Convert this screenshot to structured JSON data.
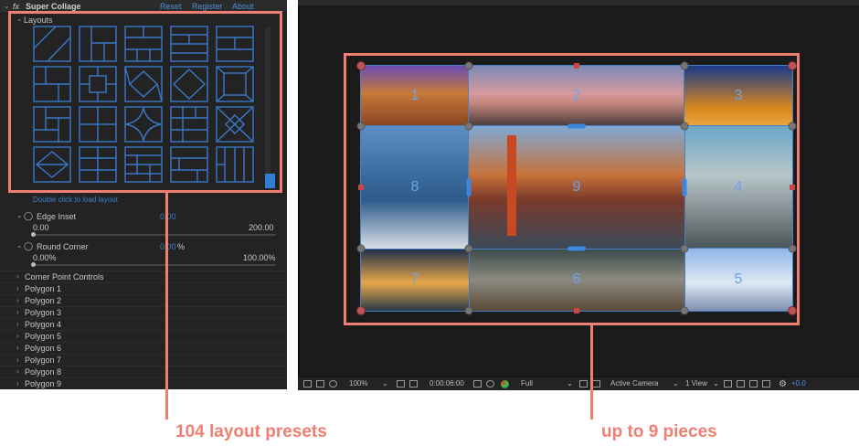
{
  "panel": {
    "fx_icon": "fx-icon",
    "title": "Super Collage",
    "links": [
      "Reset",
      "Register",
      "About"
    ],
    "layouts_label": "Layouts",
    "hint": "Double click to load layout",
    "edge_inset": {
      "label": "Edge Inset",
      "value": "0.00",
      "min": "0.00",
      "max": "200.00",
      "fraction": 0.0
    },
    "round_corner": {
      "label": "Round Corner",
      "value": "0.00",
      "unit": "%",
      "min": "0.00%",
      "max": "100.00%",
      "fraction": 0.0
    },
    "groups": [
      "Corner Point Controls",
      "Polygon 1",
      "Polygon 2",
      "Polygon 3",
      "Polygon 4",
      "Polygon 5",
      "Polygon 6",
      "Polygon 7",
      "Polygon 8",
      "Polygon 9"
    ]
  },
  "viewer": {
    "pieces": [
      "1",
      "2",
      "3",
      "4",
      "5",
      "6",
      "7",
      "8",
      "9"
    ]
  },
  "toolbar": {
    "zoom": "100%",
    "timecode": "0:00:06:00",
    "resolution": "Full",
    "camera": "Active Camera",
    "views": "1 View",
    "exposure": "+0.0"
  },
  "callouts": {
    "left": "104 layout presets",
    "right": "up to 9 pieces"
  },
  "colors": {
    "accent": "#ef7f72",
    "link": "#3b7fd1",
    "layout_stroke": "#3a78c8"
  }
}
